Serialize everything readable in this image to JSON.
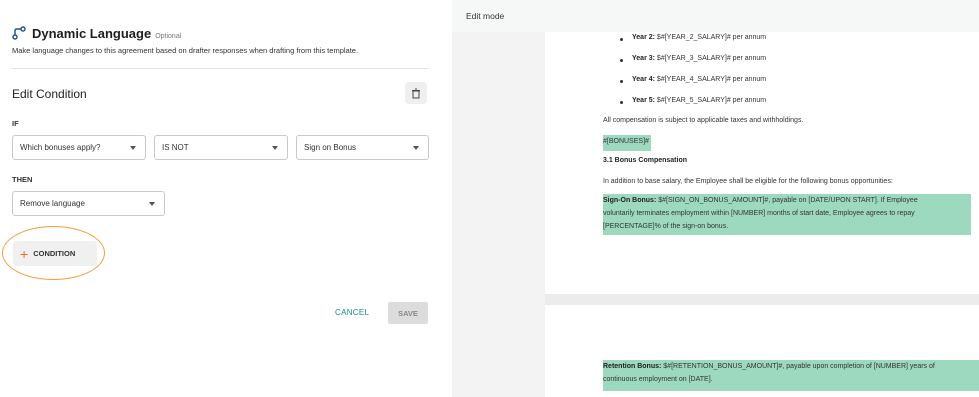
{
  "left_panel": {
    "title": "Dynamic Language",
    "optional": "Optional",
    "description": "Make language changes to this agreement based on drafter responses when drafting from this template.",
    "edit_condition": "Edit Condition",
    "if_label": "IF",
    "then_label": "THEN",
    "if_question": "Which bonuses apply?",
    "if_operator": "IS NOT",
    "if_value": "Sign on Bonus",
    "then_action": "Remove language",
    "add_condition": "CONDITION",
    "cancel": "CANCEL",
    "save": "SAVE"
  },
  "right_panel": {
    "mode": "Edit mode",
    "bullets": [
      {
        "label": "Year 2:",
        "text": "$#[YEAR_2_SALARY]# per annum"
      },
      {
        "label": "Year 3:",
        "text": "$#[YEAR_3_SALARY]# per annum"
      },
      {
        "label": "Year 4:",
        "text": "$#[YEAR_4_SALARY]# per annum"
      },
      {
        "label": "Year 5:",
        "text": "$#[YEAR_5_SALARY]# per annum"
      }
    ],
    "comp_note": "All compensation is subject to applicable taxes and withholdings.",
    "bonuses_tag": "#[BONUSES]#",
    "section_heading": "3.1 Bonus Compensation",
    "section_intro": "In addition to base salary, the Employee shall be eligible for the following bonus opportunities:",
    "signon_label": "Sign-On Bonus:",
    "signon_line1": "$#[SIGN_ON_BONUS_AMOUNT]#, payable on [DATE/UPON START]. If Employee",
    "signon_line2": "voluntarily terminates employment within [NUMBER] months of start date, Employee agrees to repay",
    "signon_line3": "[PERCENTAGE]% of the sign-on bonus.",
    "retention_label": "Retention Bonus:",
    "retention_line1": "$#[RETENTION_BONUS_AMOUNT]#, payable upon completion of [NUMBER] years of",
    "retention_line2": "continuous employment on [DATE]."
  },
  "colors": {
    "accent_orange": "#e8732a",
    "highlight_green": "#9dd9bf",
    "cancel_teal": "#1a8b8b"
  }
}
